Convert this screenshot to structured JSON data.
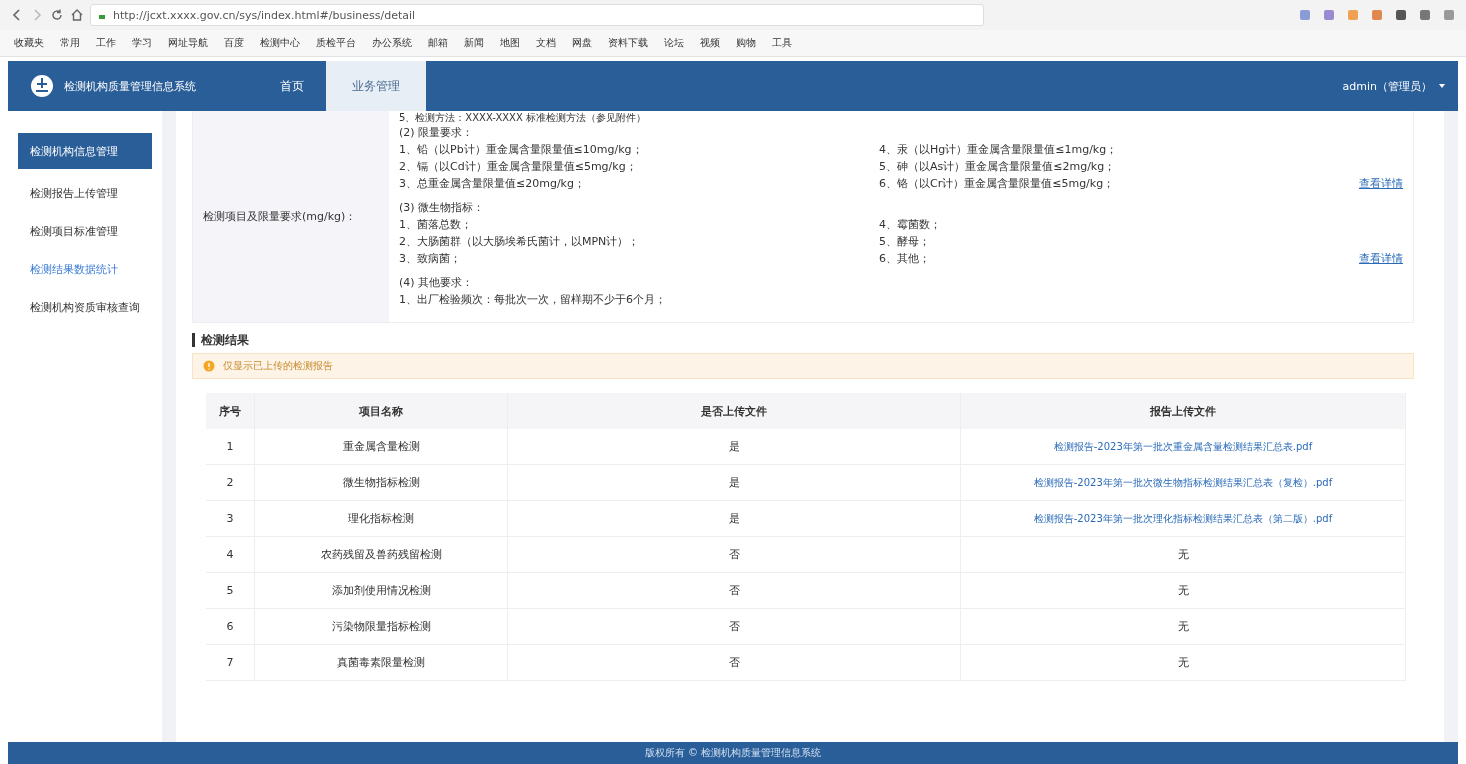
{
  "browser": {
    "url": "http://jcxt.xxxx.gov.cn/sys/index.html#/business/detail",
    "bookmarks": [
      "收藏夹",
      "常用",
      "工作",
      "学习",
      "网址导航",
      "百度",
      "检测中心",
      "质检平台",
      "办公系统",
      "邮箱",
      "新闻",
      "地图",
      "文档",
      "网盘",
      "资料下载",
      "论坛",
      "视频",
      "购物",
      "工具"
    ]
  },
  "header": {
    "title": "检测机构质量管理信息系统",
    "nav": [
      {
        "label": "首页",
        "selected": false
      },
      {
        "label": "业务管理",
        "selected": true
      }
    ],
    "user": "admin（管理员）"
  },
  "sidebar": {
    "items": [
      {
        "label": "检测机构信息管理",
        "selected": true,
        "highlighted": false
      },
      {
        "label": "检测报告上传管理",
        "selected": false,
        "highlighted": false
      },
      {
        "label": "检测项目标准管理",
        "selected": false,
        "highlighted": false
      },
      {
        "label": "检测结果数据统计",
        "selected": false,
        "highlighted": true
      },
      {
        "label": "检测机构资质审核查询",
        "selected": false,
        "highlighted": false
      }
    ]
  },
  "detail": {
    "label": "检测项目及限量要求(mg/kg)：",
    "top_line": "5、检测方法：XXXX-XXXX 标准检测方法（参见附件）",
    "groups": [
      {
        "title": "(2) 限量要求：",
        "items": [
          [
            "1、铅（以Pb计）重金属含量限量值≤10mg/kg；",
            "4、汞（以Hg计）重金属含量限量值≤1mg/kg；"
          ],
          [
            "2、镉（以Cd计）重金属含量限量值≤5mg/kg；",
            "5、砷（以As计）重金属含量限量值≤2mg/kg；"
          ],
          [
            "3、总重金属含量限量值≤20mg/kg；",
            "6、铬（以Cr计）重金属含量限量值≤5mg/kg；"
          ]
        ],
        "link": "查看详情"
      },
      {
        "title": "(3) 微生物指标：",
        "items": [
          [
            "1、菌落总数；",
            "4、霉菌数；"
          ],
          [
            "2、大肠菌群（以大肠埃希氏菌计，以MPN计）；",
            "5、酵母；"
          ],
          [
            "3、致病菌；",
            "6、其他；"
          ]
        ],
        "link": "查看详情"
      },
      {
        "title": "(4) 其他要求：",
        "items": [
          [
            "1、出厂检验频次：每批次一次，留样期不少于6个月；"
          ]
        ]
      }
    ]
  },
  "results": {
    "title": "检测结果",
    "notice": "仅显示已上传的检测报告",
    "columns": [
      "序号",
      "项目名称",
      "是否上传文件",
      "报告上传文件"
    ],
    "rows": [
      {
        "kind": "link",
        "cells": [
          "1",
          "重金属含量检测",
          "是",
          "检测报告-2023年第一批次重金属含量检测结果汇总表.pdf"
        ]
      },
      {
        "kind": "link",
        "cells": [
          "2",
          "微生物指标检测",
          "是",
          "检测报告-2023年第一批次微生物指标检测结果汇总表（复检）.pdf"
        ]
      },
      {
        "kind": "link",
        "cells": [
          "3",
          "理化指标检测",
          "是",
          "检测报告-2023年第一批次理化指标检测结果汇总表（第二版）.pdf"
        ]
      },
      {
        "kind": "text",
        "cells": [
          "4",
          "农药残留及兽药残留检测",
          "否",
          "无"
        ]
      },
      {
        "kind": "text",
        "cells": [
          "5",
          "添加剂使用情况检测",
          "否",
          "无"
        ]
      },
      {
        "kind": "text",
        "cells": [
          "6",
          "污染物限量指标检测",
          "否",
          "无"
        ]
      },
      {
        "kind": "text",
        "cells": [
          "7",
          "真菌毒素限量检测",
          "否",
          "无"
        ]
      }
    ]
  },
  "footer": "版权所有 © 检测机构质量管理信息系统"
}
